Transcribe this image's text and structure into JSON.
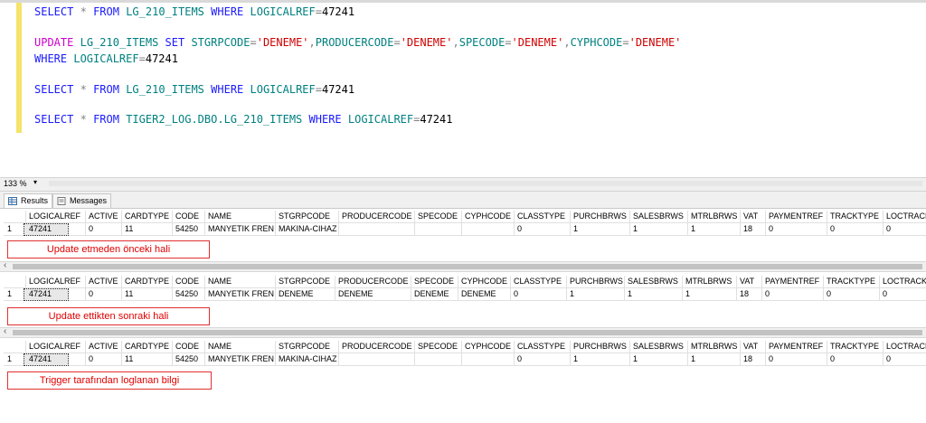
{
  "editor": {
    "line1": {
      "a": "SELECT",
      "b": "*",
      "c": "FROM",
      "d": "LG_210_ITEMS",
      "e": "WHERE",
      "f": "LOGICALREF",
      "g": "=",
      "h": "47241"
    },
    "line2": {
      "a": "UPDATE",
      "b": "LG_210_ITEMS",
      "c": "SET",
      "d": "STGRPCODE",
      "e": "=",
      "f": "'DENEME'",
      "g": ",",
      "h": "PRODUCERCODE",
      "i": "=",
      "j": "'DENEME'",
      "k": ",",
      "l": "SPECODE",
      "m": "=",
      "n": "'DENEME'",
      "o": ",",
      "p": "CYPHCODE",
      "q": "=",
      "r": "'DENEME'"
    },
    "line3": {
      "a": "WHERE",
      "b": "LOGICALREF",
      "c": "=",
      "d": "47241"
    },
    "line4": {
      "a": "SELECT",
      "b": "*",
      "c": "FROM",
      "d": "LG_210_ITEMS",
      "e": "WHERE",
      "f": "LOGICALREF",
      "g": "=",
      "h": "47241"
    },
    "line5": {
      "a": "SELECT",
      "b": "*",
      "c": "FROM",
      "d": "TIGER2_LOG.DBO.LG_210_ITEMS",
      "e": "WHERE",
      "f": "LOGICALREF",
      "g": "=",
      "h": "47241"
    }
  },
  "zoom": "133 %",
  "tabs": {
    "results": "Results",
    "messages": "Messages"
  },
  "grid1": {
    "headers": [
      "LOGICALREF",
      "ACTIVE",
      "CARDTYPE",
      "CODE",
      "NAME",
      "STGRPCODE",
      "PRODUCERCODE",
      "SPECODE",
      "CYPHCODE",
      "CLASSTYPE",
      "PURCHBRWS",
      "SALESBRWS",
      "MTRLBRWS",
      "VAT",
      "PAYMENTREF",
      "TRACKTYPE",
      "LOCTRACKI"
    ],
    "row_num": "1",
    "cells": [
      "47241",
      "0",
      "11",
      "54250",
      "MANYETIK FREN",
      "MAKINA-CIHAZ",
      "",
      "",
      "",
      "0",
      "1",
      "1",
      "1",
      "18",
      "0",
      "0",
      "0"
    ]
  },
  "grid2": {
    "headers": [
      "LOGICALREF",
      "ACTIVE",
      "CARDTYPE",
      "CODE",
      "NAME",
      "STGRPCODE",
      "PRODUCERCODE",
      "SPECODE",
      "CYPHCODE",
      "CLASSTYPE",
      "PURCHBRWS",
      "SALESBRWS",
      "MTRLBRWS",
      "VAT",
      "PAYMENTREF",
      "TRACKTYPE",
      "LOCTRACKIN"
    ],
    "row_num": "1",
    "cells": [
      "47241",
      "0",
      "11",
      "54250",
      "MANYETIK FREN",
      "DENEME",
      "DENEME",
      "DENEME",
      "DENEME",
      "0",
      "1",
      "1",
      "1",
      "18",
      "0",
      "0",
      "0"
    ]
  },
  "grid3": {
    "headers": [
      "LOGICALREF",
      "ACTIVE",
      "CARDTYPE",
      "CODE",
      "NAME",
      "STGRPCODE",
      "PRODUCERCODE",
      "SPECODE",
      "CYPHCODE",
      "CLASSTYPE",
      "PURCHBRWS",
      "SALESBRWS",
      "MTRLBRWS",
      "VAT",
      "PAYMENTREF",
      "TRACKTYPE",
      "LOCTRACKI"
    ],
    "row_num": "1",
    "cells": [
      "47241",
      "0",
      "11",
      "54250",
      "MANYETIK FREN",
      "MAKINA-CIHAZ",
      "",
      "",
      "",
      "0",
      "1",
      "1",
      "1",
      "18",
      "0",
      "0",
      "0"
    ]
  },
  "notes": {
    "n1": "Update etmeden önceki hali",
    "n2": "Update ettikten sonraki hali",
    "n3": "Trigger tarafından loglanan bilgi"
  },
  "colors": {
    "keyword": "#1a1aff",
    "update_keyword": "#cc00cc",
    "identifier": "#008080",
    "string": "#d00000",
    "note_border": "#e03030"
  }
}
